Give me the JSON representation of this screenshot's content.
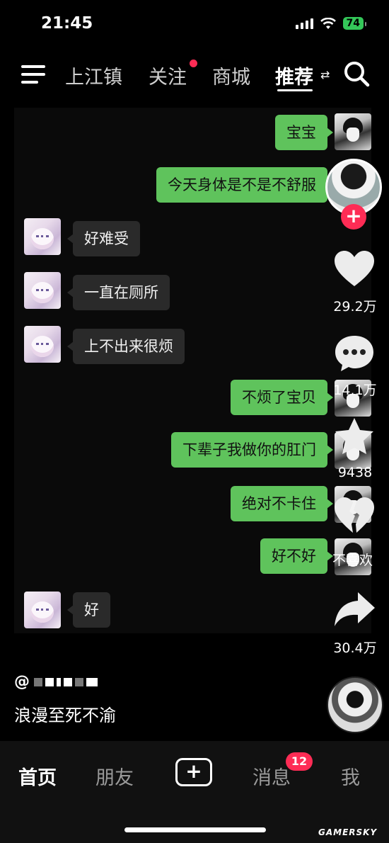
{
  "status_bar": {
    "time": "21:45",
    "battery": "74",
    "icons": [
      "signal-icon",
      "wifi-icon",
      "battery-icon"
    ]
  },
  "top_nav": {
    "menu_icon": "menu-icon",
    "tabs": [
      {
        "label": "上江镇",
        "active": false
      },
      {
        "label": "关注",
        "active": false,
        "has_dot": true
      },
      {
        "label": "商城",
        "active": false
      },
      {
        "label": "推荐",
        "active": true
      }
    ],
    "search_icon": "search-icon",
    "accent_color": "#fe2c55"
  },
  "chat": {
    "me_color": "#5fc35c",
    "messages": [
      {
        "sender": "me",
        "text": "宝宝"
      },
      {
        "sender": "me",
        "text": "今天身体是不是不舒服"
      },
      {
        "sender": "other",
        "text": "好难受"
      },
      {
        "sender": "other",
        "text": "一直在厕所"
      },
      {
        "sender": "other",
        "text": "上不出来很烦"
      },
      {
        "sender": "me",
        "text": "不烦了宝贝"
      },
      {
        "sender": "me",
        "text": "下辈子我做你的肛门"
      },
      {
        "sender": "me",
        "text": "绝对不卡住"
      },
      {
        "sender": "me",
        "text": "好不好"
      },
      {
        "sender": "other",
        "text": "好"
      }
    ]
  },
  "actions": {
    "follow_label": "+",
    "likes": "29.2万",
    "comments": "14.1万",
    "favorites": "9438",
    "dislike_label": "不喜欢",
    "shares": "30.4万"
  },
  "caption": {
    "author_prefix": "@",
    "text": "浪漫至死不渝"
  },
  "bottom_nav": {
    "items": [
      {
        "label": "首页",
        "active": true
      },
      {
        "label": "朋友",
        "active": false
      },
      {
        "label": "+",
        "active": false
      },
      {
        "label": "消息",
        "active": false,
        "badge": "12"
      },
      {
        "label": "我",
        "active": false
      }
    ]
  },
  "watermark": "GAMERSKY"
}
